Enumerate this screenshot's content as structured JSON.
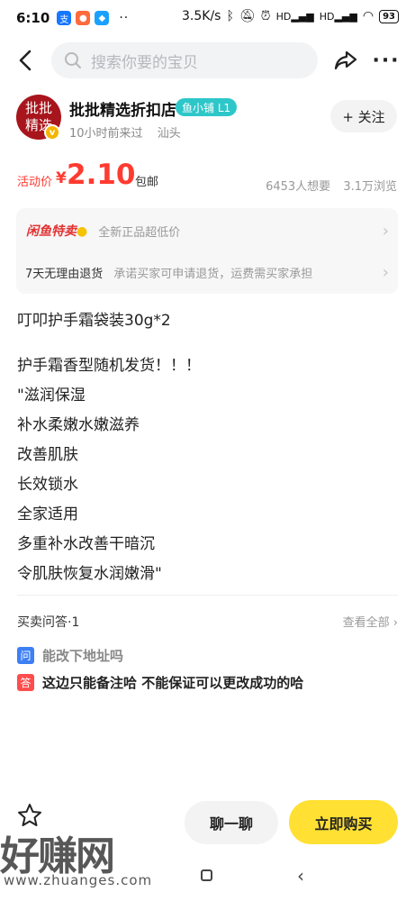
{
  "status_bar": {
    "time": "6:10",
    "network_speed": "3.5K/s",
    "signal1": "HD",
    "signal2": "HD",
    "battery": "93"
  },
  "top_bar": {
    "search_placeholder": "搜索你要的宝贝"
  },
  "seller": {
    "avatar_text": "批批精选",
    "name": "批批精选折扣店",
    "level": "鱼小铺 L1",
    "last_seen": "10小时前来过",
    "location": "汕头",
    "follow_label": "+ 关注"
  },
  "price": {
    "label": "活动价",
    "currency": "¥",
    "value": "2.10",
    "shipping": "包邮",
    "wants": "6453人想要",
    "views": "3.1万浏览"
  },
  "promo": {
    "title": "闲鱼特卖",
    "title_desc": "全新正品超低价",
    "return_label": "7天无理由退货",
    "return_desc": "承诺买家可申请退货，运费需买家承担"
  },
  "description": {
    "title": "叮叩护手霜袋装30g*2",
    "lines": [
      "护手霜香型随机发货！！！",
      "\"滋润保湿",
      "补水柔嫩水嫩滋养",
      "改善肌肤",
      "长效锁水",
      "全家适用",
      "多重补水改善干暗沉",
      "令肌肤恢复水润嫩滑\""
    ]
  },
  "qa": {
    "title": "买卖问答·1",
    "view_all": "查看全部",
    "question_tag": "问",
    "question": "能改下地址吗",
    "answer_tag": "答",
    "answer": "这边只能备注哈 不能保证可以更改成功的哈"
  },
  "bottom": {
    "chat_label": "聊一聊",
    "buy_label": "立即购买"
  },
  "watermark": {
    "brand": "好赚网",
    "url": "www.zhuanges.com"
  },
  "colors": {
    "price_red": "#ff3b30",
    "buy_yellow": "#ffe033",
    "level_teal": "#2ec7c9",
    "qa_blue": "#3d7ff5",
    "qa_red": "#ff4d4d"
  }
}
